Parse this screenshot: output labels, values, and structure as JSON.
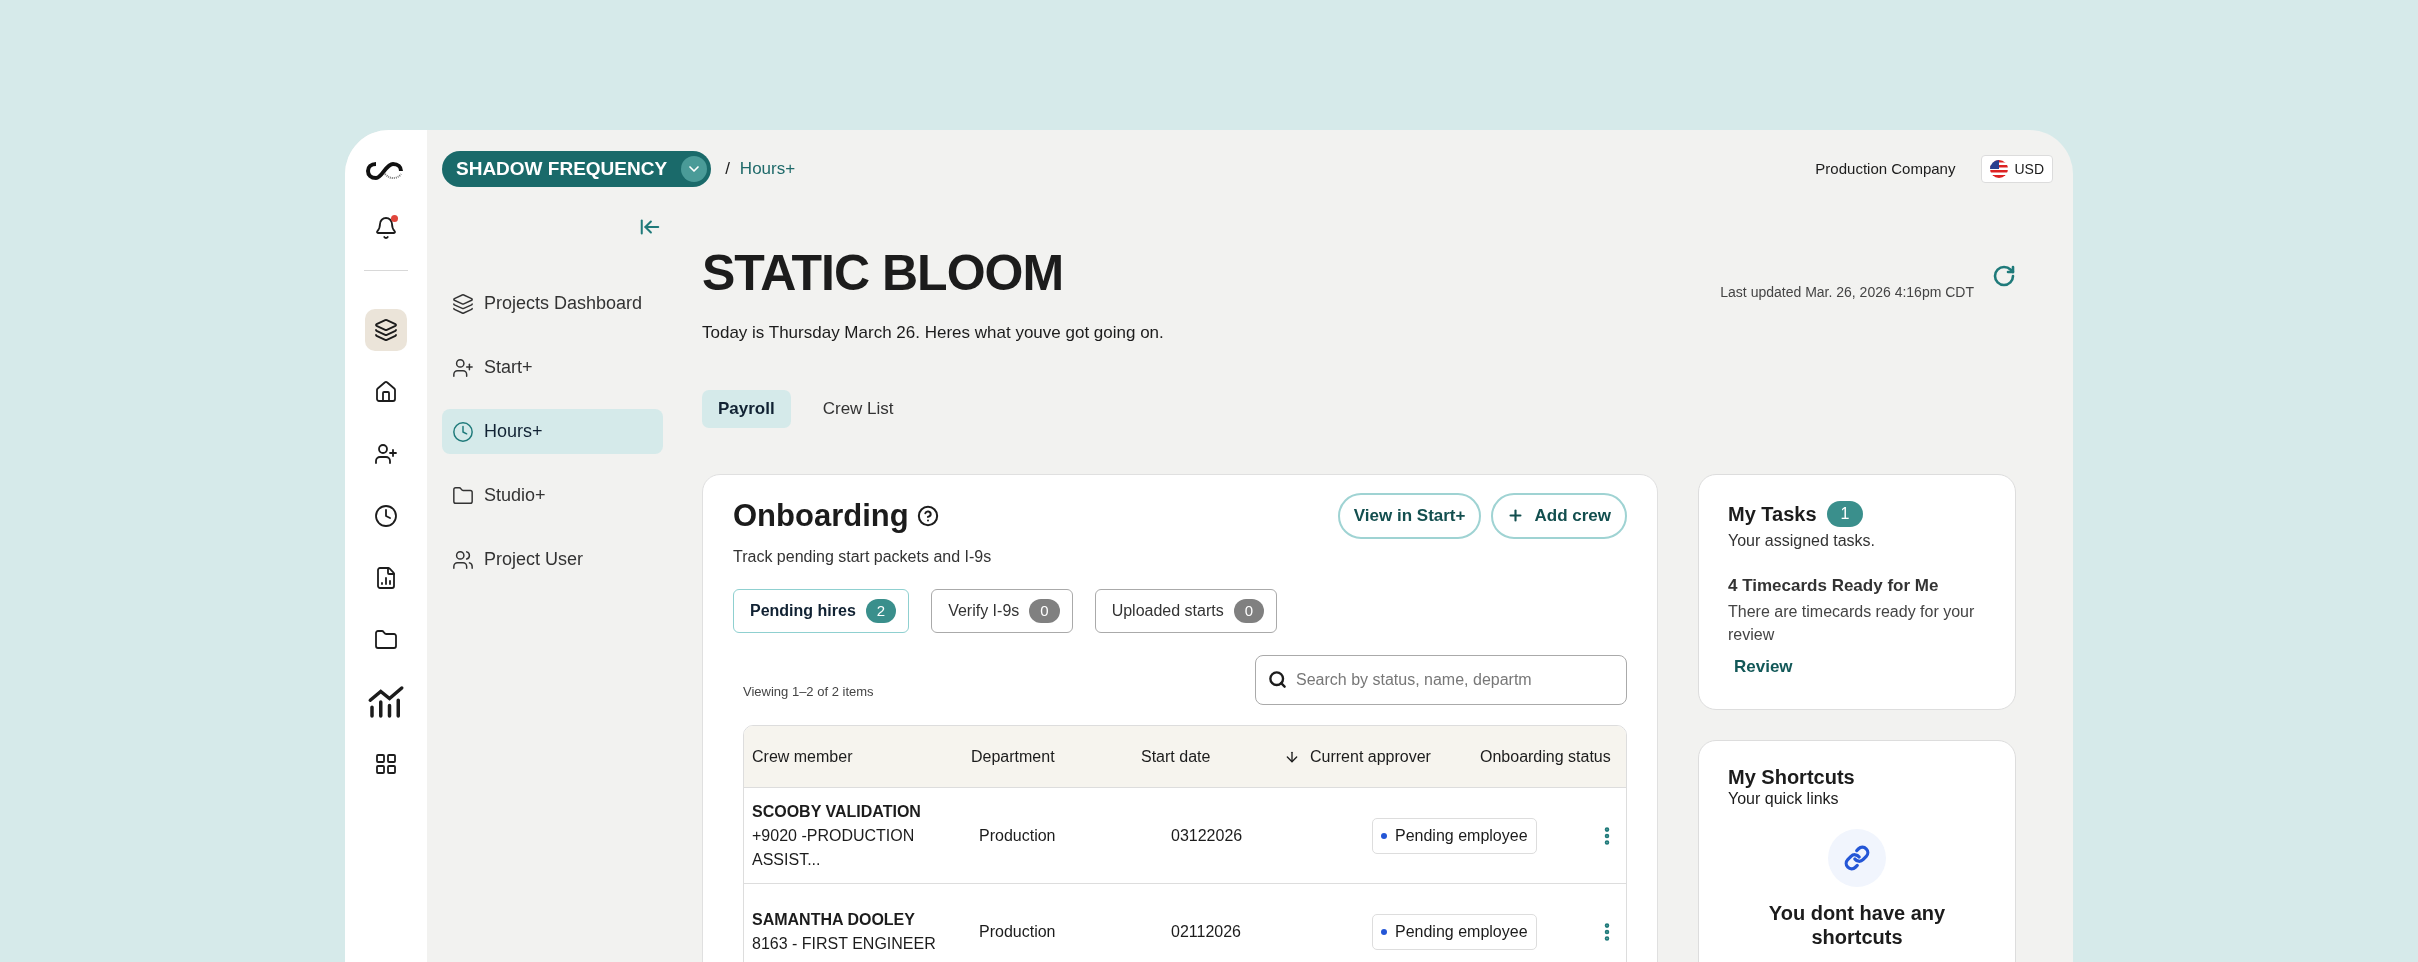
{
  "header": {
    "company": "SHADOW FREQUENCY",
    "breadcrumb_separator": "/",
    "breadcrumb": "Hours+",
    "org": "Production Company",
    "currency": "USD"
  },
  "rail": {
    "bell_unread": true,
    "items": [
      {
        "kind": "layers",
        "selected": true
      },
      {
        "kind": "home",
        "selected": false
      },
      {
        "kind": "user-plus",
        "selected": false
      },
      {
        "kind": "clock",
        "selected": false
      },
      {
        "kind": "report",
        "selected": false
      },
      {
        "kind": "folder",
        "selected": false
      },
      {
        "kind": "chart",
        "selected": false
      },
      {
        "kind": "grid",
        "selected": false
      }
    ]
  },
  "nav": [
    {
      "kind": "layers",
      "label": "Projects Dashboard",
      "selected": false
    },
    {
      "kind": "user-plus",
      "label": "Start+",
      "selected": false
    },
    {
      "kind": "clock",
      "label": "Hours+",
      "selected": true
    },
    {
      "kind": "folder",
      "label": "Studio+",
      "selected": false
    },
    {
      "kind": "users",
      "label": "Project User",
      "selected": false
    }
  ],
  "page": {
    "title": "STATIC BLOOM",
    "subtitle": "Today is Thursday March 26. Heres what youve got going on.",
    "last_updated": "Last updated Mar. 26, 2026 4:16pm CDT"
  },
  "tabs": [
    {
      "label": "Payroll",
      "selected": true
    },
    {
      "label": "Crew List",
      "selected": false
    }
  ],
  "onboarding": {
    "title": "Onboarding",
    "subtitle": "Track pending start packets and I-9s",
    "buttons": [
      {
        "kind": "plain",
        "label": "View in Start+"
      },
      {
        "kind": "add",
        "label": "Add crew"
      }
    ],
    "filters": [
      {
        "label": "Pending hires",
        "count": "2",
        "selected": true
      },
      {
        "label": "Verify I-9s",
        "count": "0",
        "selected": false
      },
      {
        "label": "Uploaded starts",
        "count": "0",
        "selected": false
      }
    ],
    "viewing": "Viewing 1–2 of 2 items",
    "search": {
      "placeholder": "Search by status, name, departm"
    },
    "columns": [
      {
        "label": "Crew member",
        "sorted": false
      },
      {
        "label": "Department",
        "sorted": false
      },
      {
        "label": "Start date",
        "sorted": true
      },
      {
        "label": "Current approver",
        "sorted": false
      },
      {
        "label": "Onboarding status",
        "sorted": false
      }
    ],
    "rows": [
      {
        "name": "SCOOBY VALIDATION",
        "role": "+9020 -PRODUCTION ASSIST...",
        "department": "Production",
        "start_date": "03122026",
        "status": "Pending employee",
        "color": "#2456d6"
      },
      {
        "name": "SAMANTHA DOOLEY",
        "role": "8163 - FIRST ENGINEER",
        "department": "Production",
        "start_date": "02112026",
        "status": "Pending employee",
        "color": "#2456d6"
      }
    ]
  },
  "tasks": {
    "title": "My Tasks",
    "count": "1",
    "subtitle": "Your assigned tasks.",
    "items": [
      {
        "title": "4 Timecards Ready for Me",
        "text": "There are timecards ready for your review",
        "link": "Review"
      }
    ]
  },
  "shortcuts": {
    "title": "My Shortcuts",
    "subtitle": "Your quick links",
    "empty": "You dont have any shortcuts"
  }
}
